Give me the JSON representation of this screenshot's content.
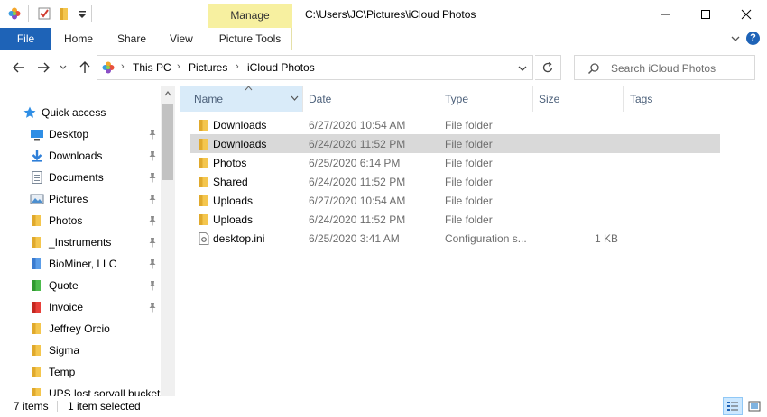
{
  "window": {
    "title_path": "C:\\Users\\JC\\Pictures\\iCloud Photos",
    "context_tab": "Manage"
  },
  "ribbon": {
    "tabs": [
      "File",
      "Home",
      "Share",
      "View"
    ],
    "context_subtab": "Picture Tools"
  },
  "address": {
    "crumbs": [
      "This PC",
      "Pictures",
      "iCloud Photos"
    ]
  },
  "search": {
    "placeholder": "Search iCloud Photos"
  },
  "sidebar": {
    "quick_access": "Quick access",
    "items": [
      {
        "label": "Desktop",
        "icon": "desktop-icon",
        "pinned": true
      },
      {
        "label": "Downloads",
        "icon": "download-icon",
        "pinned": true
      },
      {
        "label": "Documents",
        "icon": "documents-icon",
        "pinned": true
      },
      {
        "label": "Pictures",
        "icon": "pictures-icon",
        "pinned": true
      },
      {
        "label": "Photos",
        "icon": "folder-icon",
        "pinned": true
      },
      {
        "label": "_Instruments",
        "icon": "folder-icon",
        "pinned": true
      },
      {
        "label": "BioMiner, LLC",
        "icon": "blue-folder-icon",
        "pinned": true
      },
      {
        "label": "Quote",
        "icon": "green-folder-icon",
        "pinned": true
      },
      {
        "label": "Invoice",
        "icon": "red-folder-icon",
        "pinned": true
      },
      {
        "label": "Jeffrey Orcio",
        "icon": "folder-icon",
        "pinned": false
      },
      {
        "label": "Sigma",
        "icon": "folder-icon",
        "pinned": false
      },
      {
        "label": "Temp",
        "icon": "folder-icon",
        "pinned": false
      },
      {
        "label": "UPS lost sorvall buckets",
        "icon": "folder-icon",
        "pinned": false
      }
    ]
  },
  "columns": {
    "name": "Name",
    "date": "Date",
    "type": "Type",
    "size": "Size",
    "tags": "Tags"
  },
  "files": [
    {
      "name": "Downloads",
      "date": "6/27/2020 10:54 AM",
      "type": "File folder",
      "size": "",
      "icon": "folder-icon",
      "selected": false
    },
    {
      "name": "Downloads",
      "date": "6/24/2020 11:52 PM",
      "type": "File folder",
      "size": "",
      "icon": "folder-icon",
      "selected": true
    },
    {
      "name": "Photos",
      "date": "6/25/2020 6:14 PM",
      "type": "File folder",
      "size": "",
      "icon": "folder-icon",
      "selected": false
    },
    {
      "name": "Shared",
      "date": "6/24/2020 11:52 PM",
      "type": "File folder",
      "size": "",
      "icon": "folder-icon",
      "selected": false
    },
    {
      "name": "Uploads",
      "date": "6/27/2020 10:54 AM",
      "type": "File folder",
      "size": "",
      "icon": "folder-icon",
      "selected": false
    },
    {
      "name": "Uploads",
      "date": "6/24/2020 11:52 PM",
      "type": "File folder",
      "size": "",
      "icon": "folder-icon",
      "selected": false
    },
    {
      "name": "desktop.ini",
      "date": "6/25/2020 3:41 AM",
      "type": "Configuration s...",
      "size": "1 KB",
      "icon": "settings-file-icon",
      "selected": false
    }
  ],
  "status": {
    "count": "7 items",
    "selection": "1 item selected"
  },
  "colors": {
    "accent": "#1e63b7",
    "manage_tab": "#f7f0a0",
    "folder": "#f4c64e",
    "selected_row": "#d9d9d9",
    "header_active": "#d9ebf9"
  }
}
